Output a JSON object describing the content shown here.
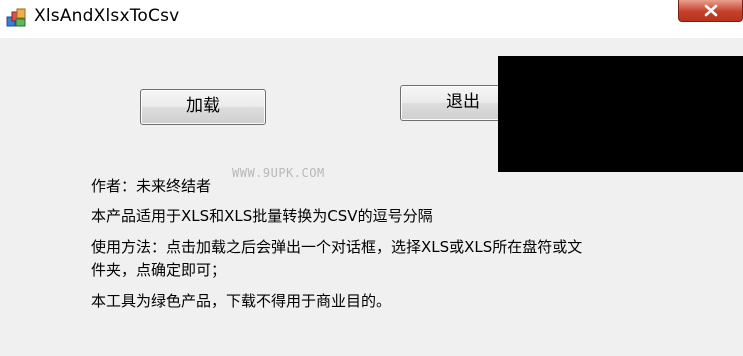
{
  "window": {
    "title": "XlsAndXlsxToCsv",
    "icon": "app-icon"
  },
  "buttons": {
    "load_label": "加载",
    "exit_label": "退出"
  },
  "watermark": "WWW.9UPK.COM",
  "info": {
    "author": "作者：未来终结者",
    "purpose": "本产品适用于XLS和XLS批量转换为CSV的逗号分隔",
    "usage_line1": "使用方法：点击加载之后会弹出一个对话框，选择XLS或XLS所在盘符或文",
    "usage_line2": "件夹，点确定即可；",
    "note": "本工具为绿色产品，下载不得用于商业目的。"
  }
}
